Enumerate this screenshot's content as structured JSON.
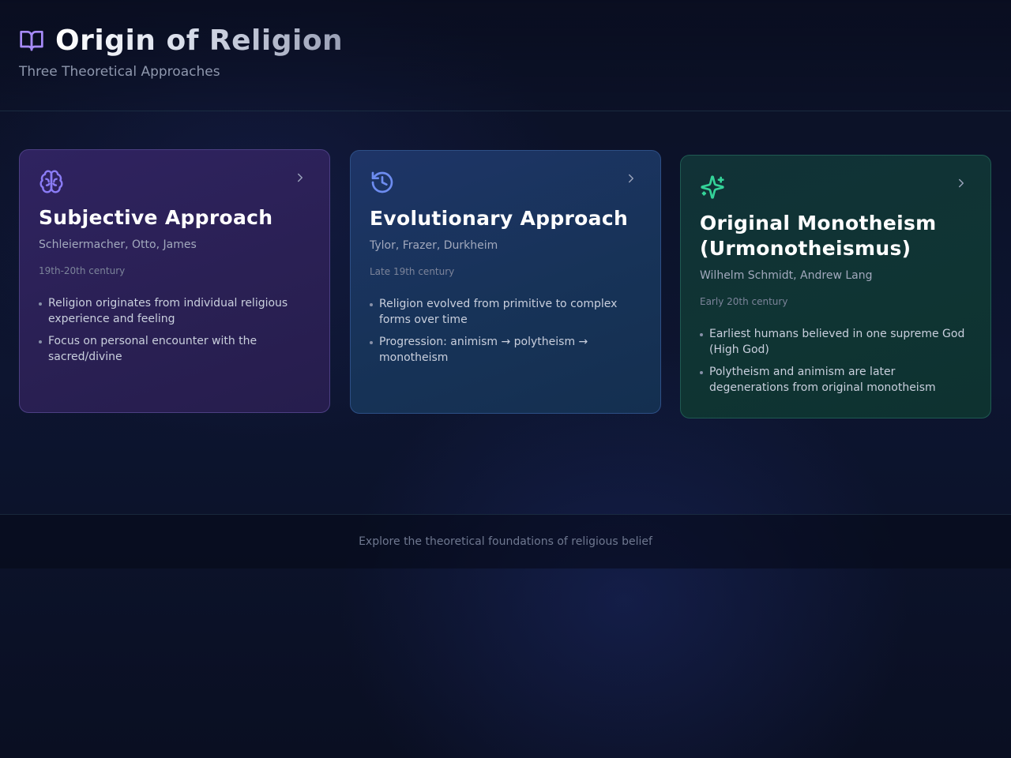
{
  "header": {
    "title": "Origin of Religion",
    "subtitle": "Three Theoretical Approaches",
    "icon": "book-open-icon"
  },
  "cards": [
    {
      "icon": "brain-icon",
      "title": "Subjective Approach",
      "authors": "Schleiermacher, Otto, James",
      "era": "19th-20th century",
      "points": [
        "Religion originates from individual religious experience and feeling",
        "Focus on personal encounter with the sacred/divine"
      ],
      "accent": "#8b7cf6"
    },
    {
      "icon": "history-icon",
      "title": "Evolutionary Approach",
      "authors": "Tylor, Frazer, Durkheim",
      "era": "Late 19th century",
      "points": [
        "Religion evolved from primitive to complex forms over time",
        "Progression: animism → polytheism → monotheism"
      ],
      "accent": "#6d8cf0"
    },
    {
      "icon": "sparkles-icon",
      "title": "Original Monotheism (Urmonotheismus)",
      "authors": "Wilhelm Schmidt, Andrew Lang",
      "era": "Early 20th century",
      "points": [
        "Earliest humans believed in one supreme God (High God)",
        "Polytheism and animism are later degenerations from original monotheism"
      ],
      "accent": "#34d399"
    }
  ],
  "footer": {
    "text": "Explore the theoretical foundations of religious belief"
  }
}
